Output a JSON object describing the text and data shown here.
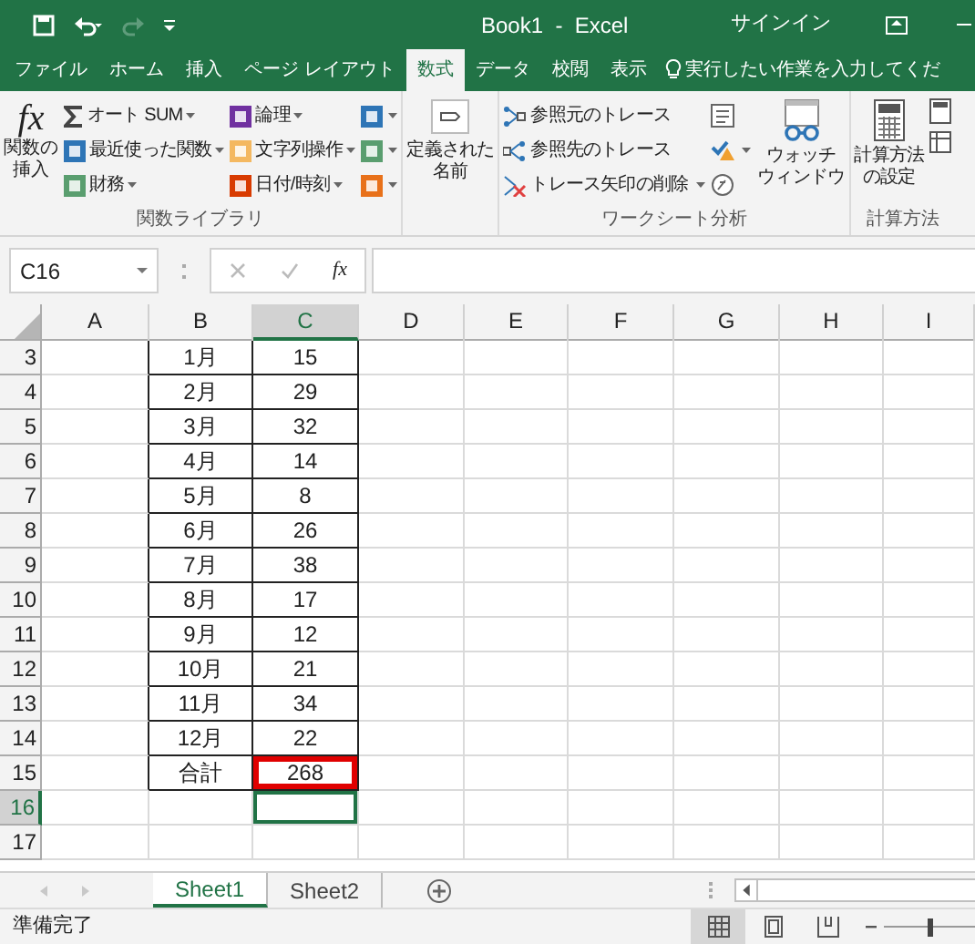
{
  "title_bar": {
    "title": "Book1  -  Excel",
    "signin": "サインイン"
  },
  "tabs": [
    {
      "label": "ファイル",
      "selected": false
    },
    {
      "label": "ホーム",
      "selected": false
    },
    {
      "label": "挿入",
      "selected": false
    },
    {
      "label": "ページ レイアウト",
      "selected": false
    },
    {
      "label": "数式",
      "selected": true
    },
    {
      "label": "データ",
      "selected": false
    },
    {
      "label": "校閲",
      "selected": false
    },
    {
      "label": "表示",
      "selected": false
    }
  ],
  "tell_me": "実行したい作業を入力してくだ",
  "ribbon": {
    "function_library": {
      "label": "関数ライブラリ",
      "icon_text": "fx",
      "insert_function": [
        "関数の",
        "挿入"
      ],
      "commands": [
        {
          "label": "オート SUM",
          "kind": "sum",
          "color": "#444444"
        },
        {
          "label": "最近使った関数",
          "kind": "box",
          "color": "#2e75b6"
        },
        {
          "label": "財務",
          "kind": "box",
          "color": "#5a9e6f"
        },
        {
          "label": "論理",
          "kind": "box",
          "color": "#7030a0"
        },
        {
          "label": "文字列操作",
          "kind": "box",
          "color": "#f4b860"
        },
        {
          "label": "日付/時刻",
          "kind": "box",
          "color": "#d83b01"
        },
        {
          "kind": "box",
          "color": "#2e75b6"
        },
        {
          "kind": "box",
          "color": "#5a9e6f"
        },
        {
          "kind": "box",
          "color": "#e8711a"
        }
      ]
    },
    "defined_names": {
      "label": [
        "定義された",
        "名前"
      ]
    },
    "formula_auditing": {
      "label": "ワークシート分析",
      "commands": [
        "参照元のトレース",
        "参照先のトレース",
        "トレース矢印の削除"
      ],
      "watch": [
        "ウォッチ",
        "ウィンドウ"
      ]
    },
    "calculation": {
      "label": "計算方法",
      "options": [
        "計算方法",
        "の設定"
      ]
    }
  },
  "name_box": "C16",
  "formula_bar": {
    "fx": "fx"
  },
  "columns": [
    {
      "label": "A",
      "selected": false
    },
    {
      "label": "B",
      "selected": false
    },
    {
      "label": "C",
      "selected": true
    },
    {
      "label": "D",
      "selected": false
    },
    {
      "label": "E",
      "selected": false
    },
    {
      "label": "F",
      "selected": false
    },
    {
      "label": "G",
      "selected": false
    },
    {
      "label": "H",
      "selected": false
    },
    {
      "label": "I",
      "selected": false
    }
  ],
  "rows": [
    {
      "number": "3",
      "selected": false,
      "b": "1月",
      "c": "15",
      "highlighted": false
    },
    {
      "number": "4",
      "selected": false,
      "b": "2月",
      "c": "29",
      "highlighted": false
    },
    {
      "number": "5",
      "selected": false,
      "b": "3月",
      "c": "32",
      "highlighted": false
    },
    {
      "number": "6",
      "selected": false,
      "b": "4月",
      "c": "14",
      "highlighted": false
    },
    {
      "number": "7",
      "selected": false,
      "b": "5月",
      "c": "8",
      "highlighted": false
    },
    {
      "number": "8",
      "selected": false,
      "b": "6月",
      "c": "26",
      "highlighted": false
    },
    {
      "number": "9",
      "selected": false,
      "b": "7月",
      "c": "38",
      "highlighted": false
    },
    {
      "number": "10",
      "selected": false,
      "b": "8月",
      "c": "17",
      "highlighted": false
    },
    {
      "number": "11",
      "selected": false,
      "b": "9月",
      "c": "12",
      "highlighted": false
    },
    {
      "number": "12",
      "selected": false,
      "b": "10月",
      "c": "21",
      "highlighted": false
    },
    {
      "number": "13",
      "selected": false,
      "b": "11月",
      "c": "34",
      "highlighted": false
    },
    {
      "number": "14",
      "selected": false,
      "b": "12月",
      "c": "22",
      "highlighted": false
    },
    {
      "number": "15",
      "selected": false,
      "b": "合計",
      "c": "268",
      "highlighted": true
    },
    {
      "number": "16",
      "selected": true
    },
    {
      "number": "17",
      "selected": false
    }
  ],
  "sheets": [
    {
      "label": "Sheet1",
      "selected": true
    },
    {
      "label": "Sheet2",
      "selected": false
    }
  ],
  "status": "準備完了",
  "views": [
    {
      "kind": "normal",
      "selected": true
    },
    {
      "kind": "page-layout",
      "selected": false
    },
    {
      "kind": "page-break",
      "selected": false
    }
  ],
  "zoom_slider": {
    "level": 0.5
  }
}
